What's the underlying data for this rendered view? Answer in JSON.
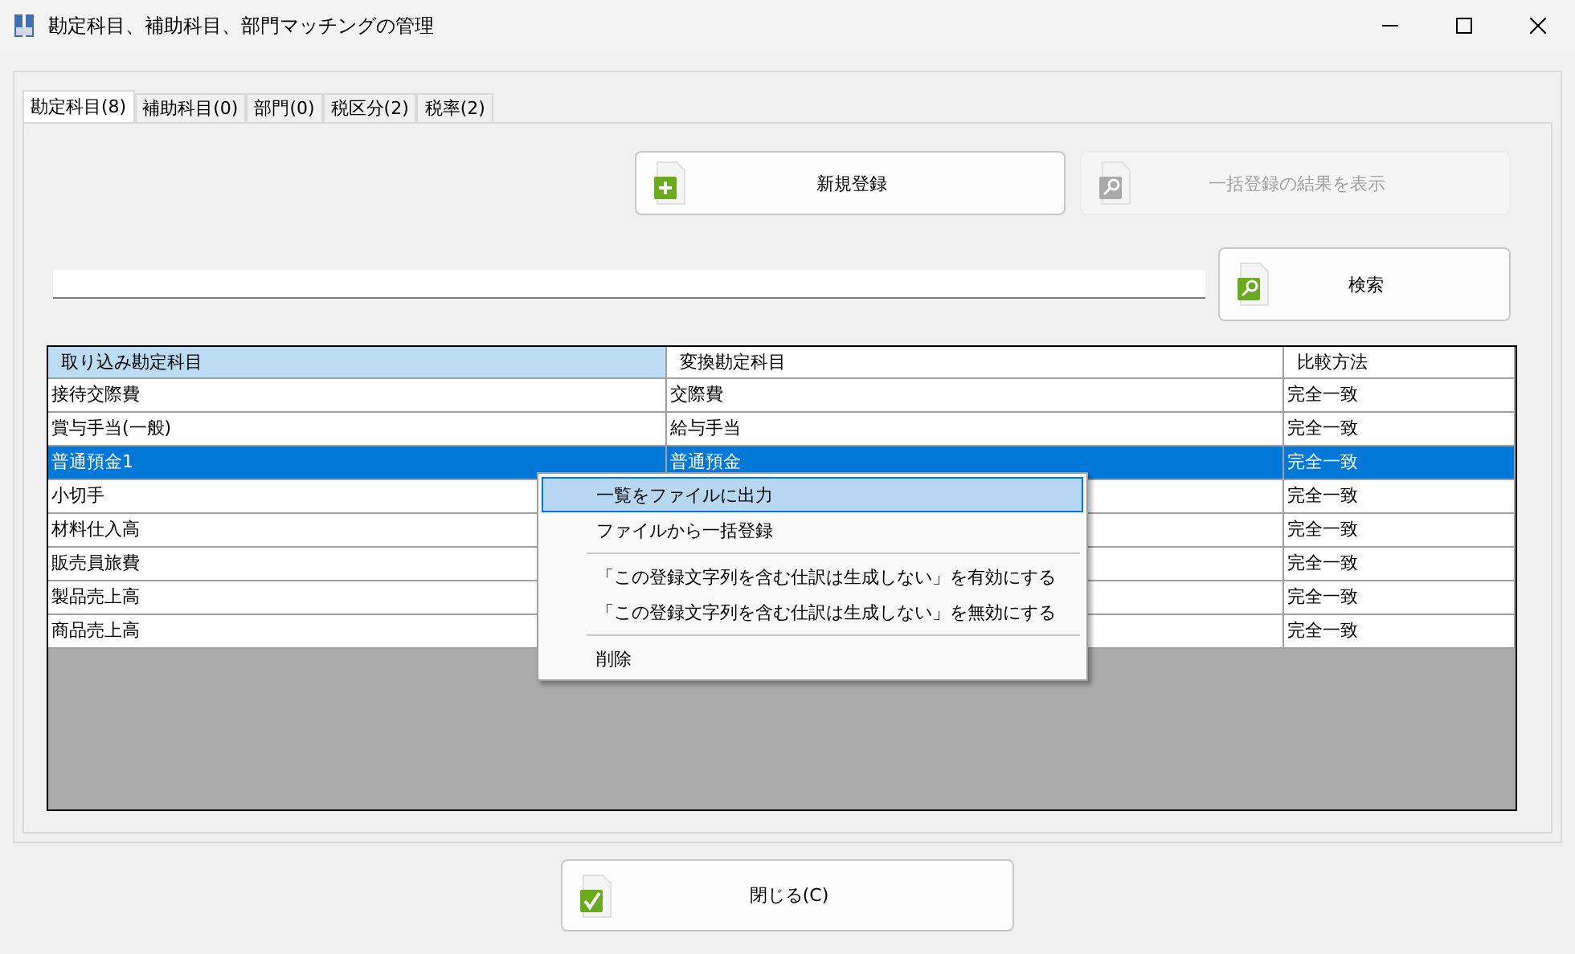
{
  "window": {
    "title": "勘定科目、補助科目、部門マッチングの管理"
  },
  "tabs": [
    {
      "label": "勘定科目(8)",
      "selected": true
    },
    {
      "label": "補助科目(0)",
      "selected": false
    },
    {
      "label": "部門(0)",
      "selected": false
    },
    {
      "label": "税区分(2)",
      "selected": false
    },
    {
      "label": "税率(2)",
      "selected": false
    }
  ],
  "actions": [
    {
      "label": "新規登録",
      "disabled": false
    },
    {
      "label": "一括登録の結果を表示",
      "disabled": true
    }
  ],
  "search": {
    "button": "検索"
  },
  "table": {
    "columns": [
      {
        "label": "取り込み勘定科目",
        "highlighted": true
      },
      {
        "label": "変換勘定科目",
        "highlighted": false
      },
      {
        "label": "比較方法",
        "highlighted": false
      }
    ],
    "rows": [
      {
        "cells": [
          "接待交際費",
          "交際費",
          "完全一致"
        ],
        "selected": false
      },
      {
        "cells": [
          "賞与手当(一般)",
          "給与手当",
          "完全一致"
        ],
        "selected": false
      },
      {
        "cells": [
          "普通預金1",
          "普通預金",
          "完全一致"
        ],
        "selected": true
      },
      {
        "cells": [
          "小切手",
          null,
          "完全一致"
        ],
        "selected": false
      },
      {
        "cells": [
          "材料仕入高",
          null,
          "完全一致"
        ],
        "selected": false
      },
      {
        "cells": [
          "販売員旅費",
          null,
          "完全一致"
        ],
        "selected": false
      },
      {
        "cells": [
          "製品売上高",
          null,
          "完全一致"
        ],
        "selected": false
      },
      {
        "cells": [
          "商品売上高",
          null,
          "完全一致"
        ],
        "selected": false
      }
    ]
  },
  "context_menu": [
    {
      "kind": "item",
      "label": "一覧をファイルに出力",
      "selected": true
    },
    {
      "kind": "item",
      "label": "ファイルから一括登録",
      "selected": false
    },
    {
      "kind": "separator"
    },
    {
      "kind": "item",
      "label": "「この登録文字列を含む仕訳は生成しない」を有効にする",
      "selected": false
    },
    {
      "kind": "item",
      "label": "「この登録文字列を含む仕訳は生成しない」を無効にする",
      "selected": false
    },
    {
      "kind": "separator"
    },
    {
      "kind": "item",
      "label": "削除",
      "selected": false
    }
  ],
  "footer": {
    "close_button": "閉じる(C)"
  }
}
